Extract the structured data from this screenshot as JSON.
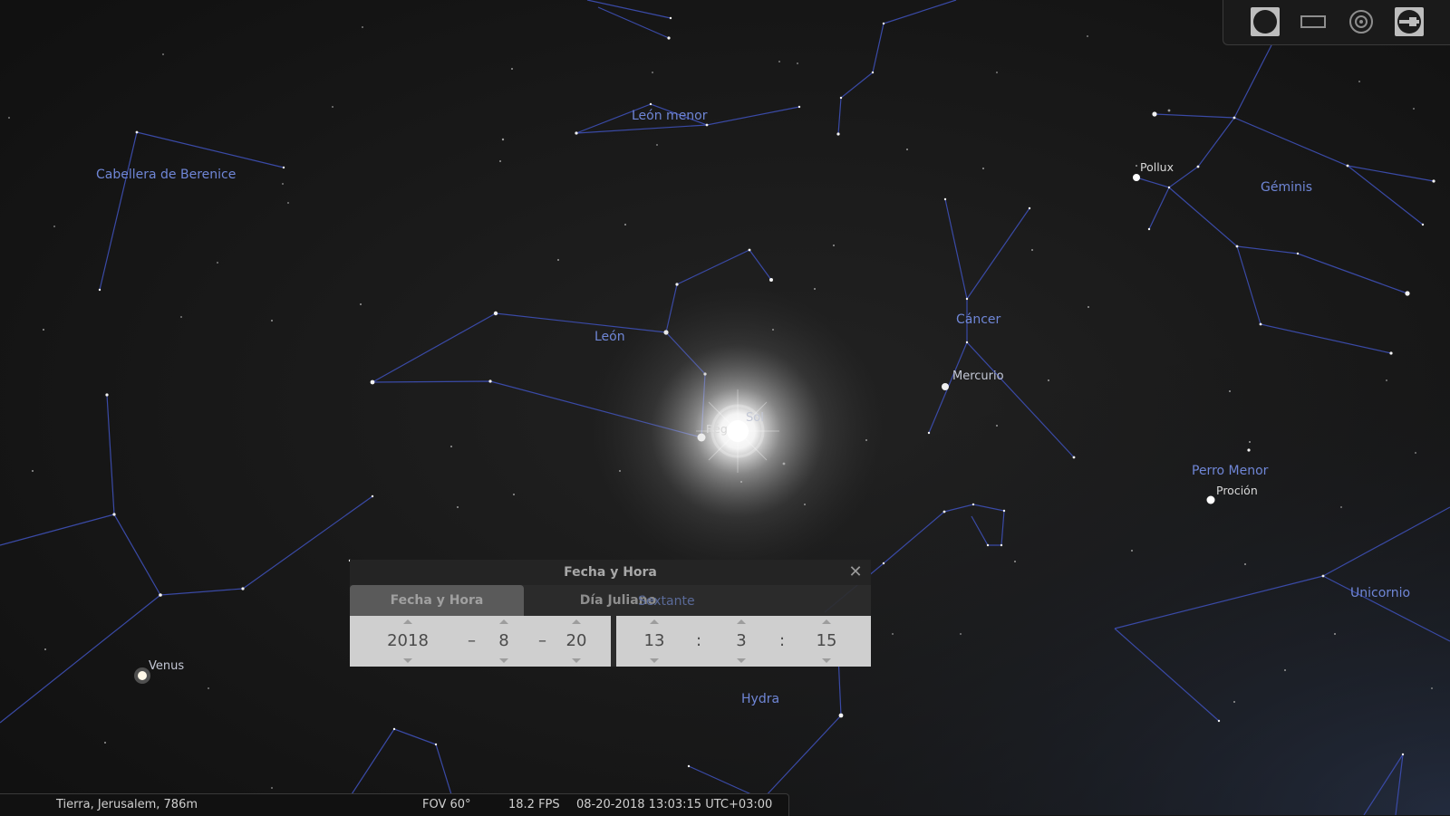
{
  "colors": {
    "sky": "#141414",
    "constellation_line": "#3a4aa6",
    "constellation_label": "#6f86d6",
    "star": "#ffffff",
    "dialog_bg": "#2d2d2d",
    "field_bg": "#cfcfcf"
  },
  "constellations": {
    "leon_menor": "León menor",
    "cabellera": "Cabellera de Berenice",
    "leon": "León",
    "cancer": "Cáncer",
    "geminis": "Géminis",
    "perro_menor": "Perro Menor",
    "unicornio": "Unicornio",
    "hydra": "Hydra"
  },
  "stars": {
    "pollux": "Pollux",
    "procion": "Proción",
    "regulo": "Rég"
  },
  "planets": {
    "sol": "Sol",
    "mercurio": "Mercurio",
    "venus": "Venus"
  },
  "toolbar": {
    "buttons": [
      "circle-icon",
      "rectangle-icon",
      "target-icon",
      "ocular-icon"
    ]
  },
  "dialog": {
    "title": "Fecha y Hora",
    "tabs": [
      "Fecha y Hora",
      "Día Juliano"
    ],
    "overlay_label": "Sextante",
    "date": {
      "year": "2018",
      "month": "8",
      "day": "20",
      "separator": "–"
    },
    "time": {
      "hour": "13",
      "minute": "3",
      "second": "15",
      "separator": ":"
    }
  },
  "status": {
    "location": "Tierra, Jerusalem, 786m",
    "fov": "FOV 60°",
    "fps": "18.2 FPS",
    "datetime": "08-20-2018 13:03:15 UTC+03:00"
  }
}
